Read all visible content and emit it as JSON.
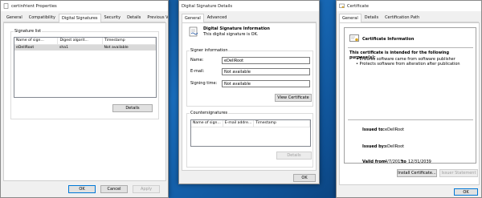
{
  "props_window": {
    "title": "certinfrient Properties",
    "tabs": [
      "General",
      "Compatibility",
      "Digital Signatures",
      "Security",
      "Details",
      "Previous Versions"
    ],
    "group_label": "Signature list",
    "columns": [
      "Name of sign...",
      "Digest algorit...",
      "Timestamp"
    ],
    "rows": [
      [
        "eDellRoot",
        "sha1",
        "Not available"
      ]
    ],
    "details_button": "Details",
    "ok_button": "OK",
    "cancel_button": "Cancel",
    "apply_button": "Apply"
  },
  "sig_window": {
    "title": "Digital Signature Details",
    "tabs": [
      "General",
      "Advanced"
    ],
    "info_title": "Digital Signature Information",
    "info_text": "This digital signature is OK.",
    "signer_group": "Signer information",
    "name_label": "Name:",
    "name_value": "eDellRoot",
    "email_label": "E-mail:",
    "email_value": "Not available",
    "signing_time_label": "Signing time:",
    "signing_time_value": "Not available",
    "view_cert_button": "View Certificate",
    "counter_group": "Countersignatures",
    "counter_columns": [
      "Name of sign...",
      "E-mail addre...",
      "Timestamp"
    ],
    "counter_details_button": "Details",
    "ok_button": "OK"
  },
  "cert_window": {
    "title": "Certificate",
    "tabs": [
      "General",
      "Details",
      "Certification Path"
    ],
    "info_title": "Certificate Information",
    "purpose_heading": "This certificate is intended for the following purpose(s):",
    "purposes": [
      "Ensures software came from software publisher",
      "Protects software from alteration after publication"
    ],
    "issued_to_label": "Issued to:",
    "issued_to_value": "eDellRoot",
    "issued_by_label": "Issued by:",
    "issued_by_value": "eDellRoot",
    "valid_from_label": "Valid from",
    "valid_from_value": "4/7/2015",
    "valid_to_label": "to",
    "valid_to_value": "12/31/2039",
    "install_button": "Install Certificate...",
    "issuer_statement_button": "Issuer Statement",
    "ok_button": "OK"
  },
  "colors": {
    "desktop": "#0d5a9e",
    "window": "#f0f0f0",
    "accent": "#0078d7"
  }
}
